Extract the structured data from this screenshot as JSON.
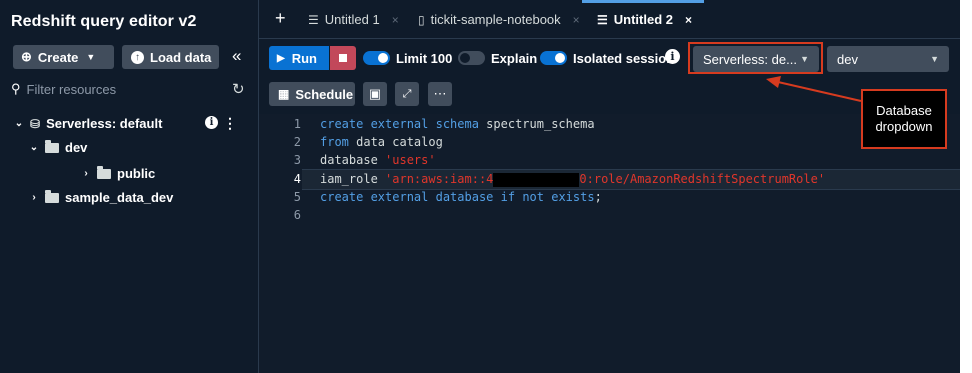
{
  "app": {
    "title": "Redshift query editor v2"
  },
  "sidebar": {
    "create_label": "Create",
    "load_label": "Load data",
    "filter_placeholder": "Filter resources",
    "tree": [
      {
        "label": "Serverless: default"
      },
      {
        "label": "dev"
      },
      {
        "label": "public"
      },
      {
        "label": "sample_data_dev"
      }
    ]
  },
  "tabs": [
    {
      "label": "Untitled 1"
    },
    {
      "label": "tickit-sample-notebook"
    },
    {
      "label": "Untitled 2"
    }
  ],
  "toolbar": {
    "run_label": "Run",
    "limit_label": "Limit 100",
    "explain_label": "Explain",
    "isolated_label": "Isolated session",
    "workgroup_value": "Serverless: de...",
    "database_value": "dev",
    "schedule_label": "Schedule",
    "limit_on": true,
    "explain_on": false,
    "isolated_on": true
  },
  "editor": {
    "line_numbers": [
      "1",
      "2",
      "3",
      "4",
      "5",
      "6"
    ],
    "lines": {
      "l1_kw": "create external schema",
      "l1_rest": " spectrum_schema",
      "l2_kw": "from",
      "l2_rest": " data catalog",
      "l3_kw": "database",
      "l3_str": "'users'",
      "l4_kw": "iam_role",
      "l4_str_a": "'arn:aws:iam::4",
      "l4_str_b": "0:role/AmazonRedshiftSpectrumRole'",
      "l5_kw_a": "create external database if",
      "l5_kw_b": "not",
      "l5_kw_c": "exists",
      "l5_rest": ";"
    }
  },
  "annotation": {
    "line1": "Database",
    "line2": "dropdown"
  },
  "colors": {
    "accent": "#0972d3",
    "annotation": "#d63b1f",
    "background": "#0f1b2a"
  }
}
